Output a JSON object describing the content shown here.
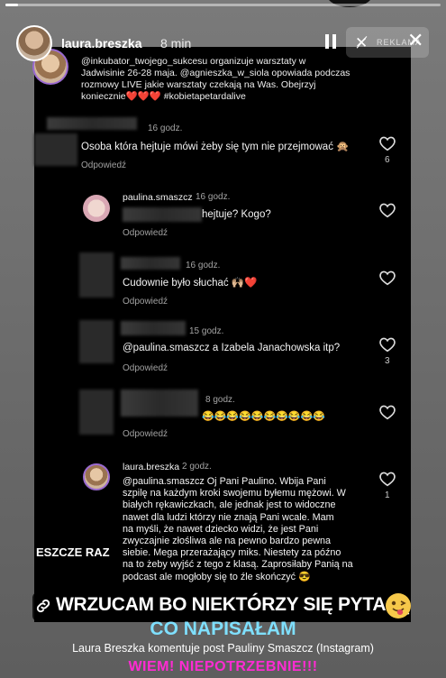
{
  "story": {
    "progress_fraction": 0.03,
    "username": "laura.breszka",
    "time": "8 min",
    "ad_label": "REKLAMA",
    "icons": [
      "pause-icon",
      "mute-icon",
      "close-icon"
    ]
  },
  "post": {
    "caption": "@inkubator_twojego_sukcesu organizuje warsztaty w Jadwisinie 26-28 maja. @agnieszka_w_siola opowiada podczas rozmowy LIVE jakie warsztaty czekają na Was. Obejrzyj koniecznie❤️❤️❤️ #kobietapetardalive"
  },
  "comments": [
    {
      "time": "16 godz.",
      "text": "Osoba która hejtuje mówi żeby się tym nie przejmować 🙊",
      "reply": "Odpowiedź",
      "likes": "6"
    },
    {
      "name": "paulina.smaszcz",
      "time": "16 godz.",
      "text": "hejtuje? Kogo?",
      "reply": "Odpowiedź"
    },
    {
      "time": "16 godz.",
      "text": "Cudownie było słuchać 🙌🏼❤️",
      "reply": "Odpowiedź"
    },
    {
      "time": "15 godz.",
      "text": "@paulina.smaszcz a Izabela Janachowska itp?",
      "reply": "Odpowiedź",
      "likes": "3"
    },
    {
      "time": "8 godz.",
      "text": "😂😂😂😂😂😂😂😂😂😂",
      "reply": "Odpowiedź"
    },
    {
      "name": "laura.breszka",
      "time": "2 godz.",
      "text_lines": [
        "@paulina.smaszcz Oj Pani Paulino. Wbija Pani",
        "szpilę na każdym kroki swojemu byłemu mężowi. W",
        "białych rękawiczkach, ale jednak jest to widoczne",
        "nawet dla ludzi którzy nie znają Pani wcale. Mam",
        "na myśli, że nawet dziecko widzi, że jest Pani",
        "zwyczajnie złośliwa ale na pewno bardzo pewna",
        "siebie. Mega przerażający miks. Niestety za późno",
        "na to żeby wyjść z tego z klasą. Zaprosiłaby Panią na",
        "podcast ale mogłoby się to źle skończyć 😎"
      ],
      "likes": "1"
    }
  ],
  "overlay": {
    "jeszcze": "ESZCZE RAZ",
    "banner": "WRZUCAM BO NIEKTÓRZY SIĘ PYTAJĄ",
    "co": "CO NAPISAŁAM",
    "source": "Laura Breszka komentuje post Pauliny Smaszcz (Instagram)",
    "wiem": "WIEM! NIEPOTRZEBNIE!!!"
  },
  "colors": {
    "banner_cyan": "#7fe0ff",
    "wiem_pink": "#ff2bd3"
  }
}
